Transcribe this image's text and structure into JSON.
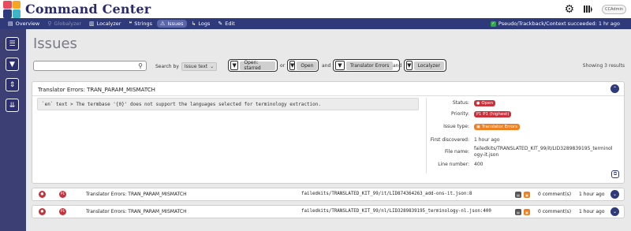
{
  "app": {
    "title": "Command Center",
    "user": "CCAdmin"
  },
  "colors": {
    "brand": "#2e3a7a",
    "rail": "#3b3f74",
    "error_red": "#c8323c",
    "warning_orange": "#f07f20",
    "success_green": "#2ea84a"
  },
  "nav": {
    "items": [
      {
        "label": "Overview",
        "icon": "overview-icon",
        "state": "normal"
      },
      {
        "label": "Globalyzer",
        "icon": "globalyzer-icon",
        "state": "disabled"
      },
      {
        "label": "Localyzer",
        "icon": "localyzer-icon",
        "state": "normal"
      },
      {
        "label": "Strings",
        "icon": "strings-icon",
        "state": "normal"
      },
      {
        "label": "Issues",
        "icon": "warning-icon",
        "state": "active"
      },
      {
        "label": "Logs",
        "icon": "logs-icon",
        "state": "normal"
      },
      {
        "label": "Edit",
        "icon": "edit-icon",
        "state": "normal"
      }
    ],
    "status": "Pseudo/Trackback/Context succeeded: 1 hr ago"
  },
  "page": {
    "title": "Issues"
  },
  "search": {
    "placeholder": "",
    "by_label": "Search by",
    "by_value": "Issue text"
  },
  "filters": [
    {
      "label": "Open: starred"
    },
    {
      "conj": "or",
      "label": "Open"
    },
    {
      "conj": "and",
      "label": "Translator Errors"
    },
    {
      "conj": "and",
      "label": "Localyzer"
    }
  ],
  "showing": "Showing 3 results",
  "expanded": {
    "title": "Translator Errors: TRAN_PARAM_MISMATCH",
    "message": "`en` text > The termbase '{0}' does not support the languages selected for terminology extraction.",
    "status_label": "Status:",
    "status_value": "Open",
    "priority_label": "Priority:",
    "priority_value": "P1 (highest)",
    "priority_icon": "P1",
    "type_label": "Issue type:",
    "type_value": "Translator Errors",
    "discovered_label": "First discovered:",
    "discovered_value": "1 hour ago",
    "file_label": "File name:",
    "file_value_1": "failedkits/TRANSLATED_KIT_99/it/LID3289839195_terminol",
    "file_value_2": "ogy-it.json",
    "line_label": "Line number:",
    "line_value": "400"
  },
  "rows": [
    {
      "title": "Translator Errors: TRAN_PARAM_MISMATCH",
      "file": "failedkits/TRANSLATED_KIT_99/it/LID874364263_add-ons-it.json:8",
      "comments": "0 comment(s)",
      "age": "1 hour ago"
    },
    {
      "title": "Translator Errors: TRAN_PARAM_MISMATCH",
      "file": "failedkits/TRANSLATED_KIT_99/nl/LID3289839195_terminology-nl.json:400",
      "comments": "0 comment(s)",
      "age": "1 hour ago"
    }
  ]
}
